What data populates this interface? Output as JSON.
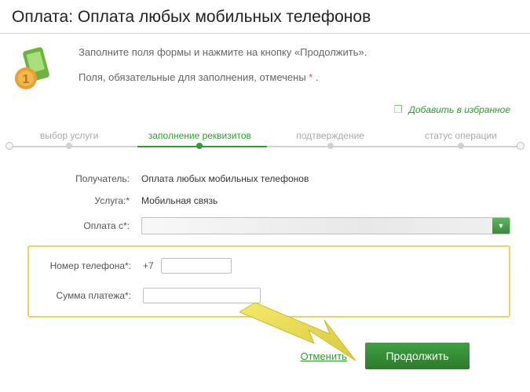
{
  "page_title": "Оплата: Оплата любых мобильных телефонов",
  "intro": {
    "line1": "Заполните поля формы и нажмите на кнопку «Продолжить».",
    "line2_prefix": "Поля, обязательные для заполнения, отмечены ",
    "line2_suffix": " ."
  },
  "favorite": {
    "label": "Добавить в избранное",
    "icon": "bookmark-icon"
  },
  "steps": {
    "items": [
      {
        "label": "выбор услуги",
        "active": false
      },
      {
        "label": "заполнение реквизитов",
        "active": true
      },
      {
        "label": "подтверждение",
        "active": false
      },
      {
        "label": "статус операции",
        "active": false
      }
    ]
  },
  "form": {
    "recipient": {
      "label": "Получатель:",
      "value": "Оплата любых мобильных телефонов"
    },
    "service": {
      "label": "Услуга:*",
      "value": "Мобильная связь"
    },
    "pay_from": {
      "label": "Оплата с*:",
      "value": ""
    },
    "phone": {
      "label": "Номер телефона*:",
      "prefix": "+7",
      "value": ""
    },
    "amount": {
      "label": "Сумма платежа*:",
      "value": ""
    }
  },
  "required_marker": "*",
  "actions": {
    "cancel": "Отменить",
    "continue": "Продолжить"
  },
  "colors": {
    "accent": "#2e9e2e",
    "highlight_border": "#f0d060",
    "required": "#d9534f"
  }
}
